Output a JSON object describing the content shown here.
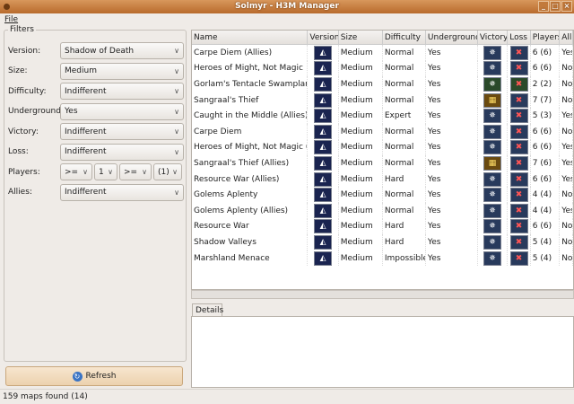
{
  "window": {
    "title": "Solmyr - H3M Manager"
  },
  "menu": {
    "file": "File"
  },
  "filters": {
    "title": "Filters",
    "version": {
      "label": "Version:",
      "value": "Shadow of Death"
    },
    "size": {
      "label": "Size:",
      "value": "Medium"
    },
    "difficulty": {
      "label": "Difficulty:",
      "value": "Indifferent"
    },
    "underground": {
      "label": "Underground:",
      "value": "Yes"
    },
    "victory": {
      "label": "Victory:",
      "value": "Indifferent"
    },
    "loss": {
      "label": "Loss:",
      "value": "Indifferent"
    },
    "players": {
      "label": "Players:",
      "op1": ">=",
      "val1": "1",
      "op2": ">=",
      "val2": "(1)"
    },
    "allies": {
      "label": "Allies:",
      "value": "Indifferent"
    },
    "refresh": "Refresh"
  },
  "table": {
    "columns": [
      "Name",
      "Version",
      "Size",
      "Difficulty",
      "Underground",
      "Victory",
      "Loss",
      "Players",
      "Allies"
    ],
    "rows": [
      {
        "name": "Carpe Diem (Allies)",
        "size": "Medium",
        "difficulty": "Normal",
        "underground": "Yes",
        "victory": "standard",
        "loss": "standard",
        "players": "6 (6)",
        "allies": "Yes"
      },
      {
        "name": "Heroes of Might, Not Magic",
        "size": "Medium",
        "difficulty": "Normal",
        "underground": "Yes",
        "victory": "standard",
        "loss": "standard",
        "players": "6 (6)",
        "allies": "No"
      },
      {
        "name": "Gorlam's Tentacle Swampland",
        "size": "Medium",
        "difficulty": "Normal",
        "underground": "Yes",
        "victory": "special",
        "loss": "special",
        "players": "2 (2)",
        "allies": "No"
      },
      {
        "name": "Sangraal's Thief",
        "size": "Medium",
        "difficulty": "Normal",
        "underground": "Yes",
        "victory": "artifact",
        "loss": "standard",
        "players": "7 (7)",
        "allies": "No"
      },
      {
        "name": "Caught in the Middle (Allies)",
        "size": "Medium",
        "difficulty": "Expert",
        "underground": "Yes",
        "victory": "standard",
        "loss": "standard",
        "players": "5 (3)",
        "allies": "Yes"
      },
      {
        "name": "Carpe Diem",
        "size": "Medium",
        "difficulty": "Normal",
        "underground": "Yes",
        "victory": "standard",
        "loss": "standard",
        "players": "6 (6)",
        "allies": "No"
      },
      {
        "name": "Heroes of Might, Not Magic (A)",
        "size": "Medium",
        "difficulty": "Normal",
        "underground": "Yes",
        "victory": "standard",
        "loss": "standard",
        "players": "6 (6)",
        "allies": "Yes"
      },
      {
        "name": "Sangraal's Thief (Allies)",
        "size": "Medium",
        "difficulty": "Normal",
        "underground": "Yes",
        "victory": "artifact",
        "loss": "standard",
        "players": "7 (6)",
        "allies": "Yes"
      },
      {
        "name": "Resource War (Allies)",
        "size": "Medium",
        "difficulty": "Hard",
        "underground": "Yes",
        "victory": "standard",
        "loss": "standard",
        "players": "6 (6)",
        "allies": "Yes"
      },
      {
        "name": "Golems Aplenty",
        "size": "Medium",
        "difficulty": "Normal",
        "underground": "Yes",
        "victory": "standard",
        "loss": "standard",
        "players": "4 (4)",
        "allies": "No"
      },
      {
        "name": "Golems Aplenty (Allies)",
        "size": "Medium",
        "difficulty": "Normal",
        "underground": "Yes",
        "victory": "standard",
        "loss": "standard",
        "players": "4 (4)",
        "allies": "Yes"
      },
      {
        "name": "Resource War",
        "size": "Medium",
        "difficulty": "Hard",
        "underground": "Yes",
        "victory": "standard",
        "loss": "standard",
        "players": "6 (6)",
        "allies": "No"
      },
      {
        "name": "Shadow Valleys",
        "size": "Medium",
        "difficulty": "Hard",
        "underground": "Yes",
        "victory": "standard",
        "loss": "standard",
        "players": "5 (4)",
        "allies": "No"
      },
      {
        "name": "Marshland Menace",
        "size": "Medium",
        "difficulty": "Impossible",
        "underground": "Yes",
        "victory": "standard",
        "loss": "standard",
        "players": "5 (4)",
        "allies": "No"
      }
    ]
  },
  "details": {
    "tab": "Details"
  },
  "status": "159 maps found (14)"
}
